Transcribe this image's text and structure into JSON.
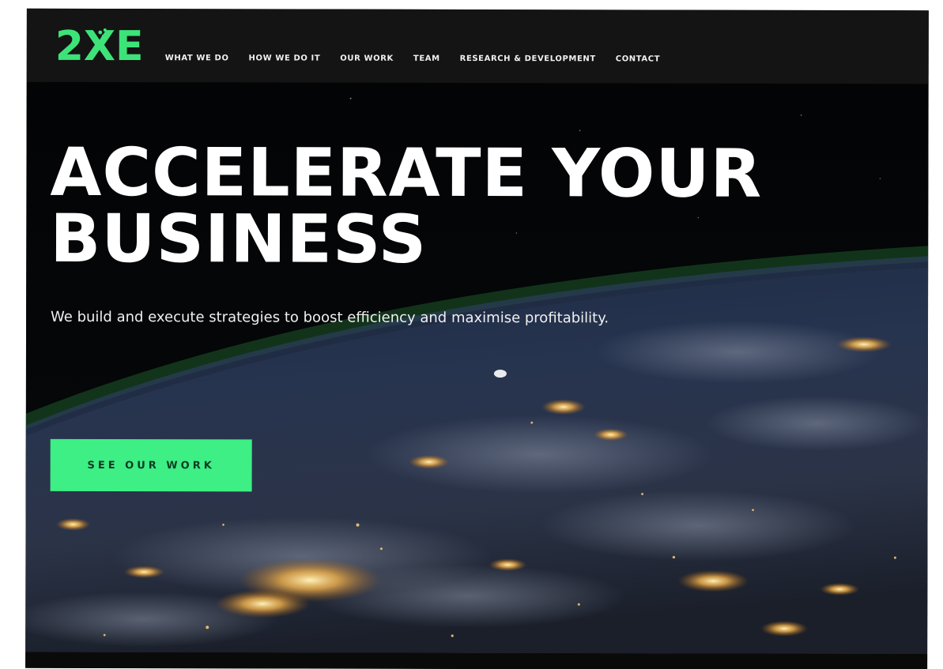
{
  "logo": {
    "text": "2XE",
    "color": "#3de379"
  },
  "nav": {
    "items": [
      {
        "label": "WHAT WE DO"
      },
      {
        "label": "HOW WE DO IT"
      },
      {
        "label": "OUR WORK"
      },
      {
        "label": "TEAM"
      },
      {
        "label": "RESEARCH & DEVELOPMENT"
      },
      {
        "label": "CONTACT"
      }
    ]
  },
  "hero": {
    "headline_line1": "ACCELERATE YOUR",
    "headline_line2": "BUSINESS",
    "subtitle": "We build and execute strategies to boost efficiency and maximise profitability.",
    "cta_label": "SEE OUR WORK",
    "accent_color": "#3def84",
    "background_icon": "earth-at-night-image"
  }
}
